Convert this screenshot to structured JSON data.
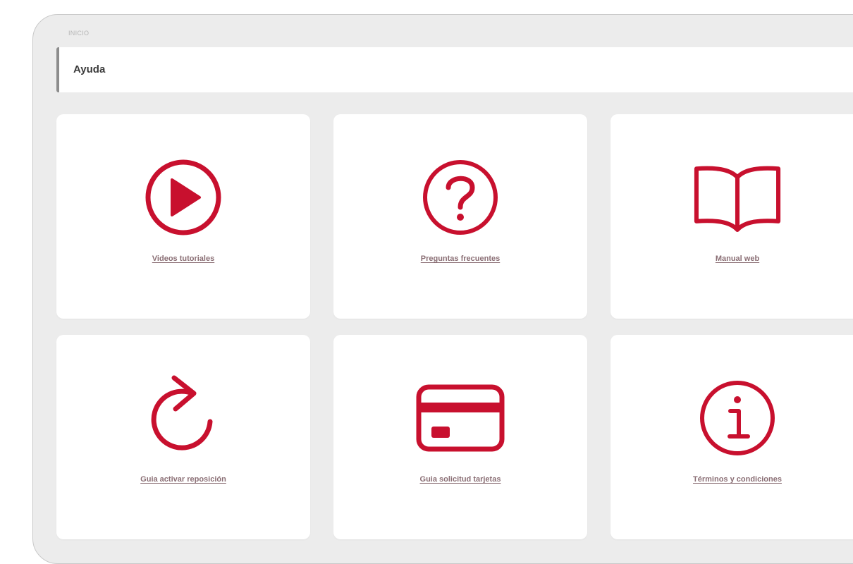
{
  "breadcrumb": "INICIO",
  "page_title": "Ayuda",
  "accent_color": "#c8102e",
  "cards": [
    {
      "label": "Videos tutoriales",
      "icon": "play-circle-icon"
    },
    {
      "label": "Preguntas frecuentes",
      "icon": "question-circle-icon"
    },
    {
      "label": "Manual web",
      "icon": "open-book-icon"
    },
    {
      "label": "Guia activar reposición",
      "icon": "refresh-arrow-icon"
    },
    {
      "label": "Guia solicitud tarjetas",
      "icon": "credit-card-icon"
    },
    {
      "label": "Términos y condiciones",
      "icon": "info-circle-icon"
    }
  ]
}
